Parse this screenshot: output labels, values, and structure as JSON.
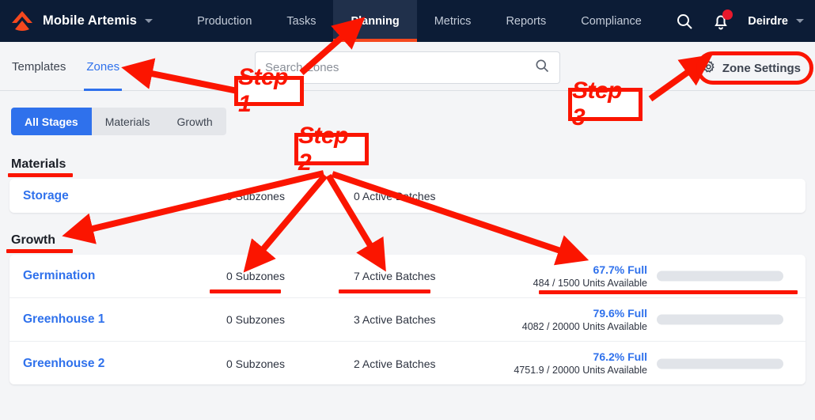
{
  "topnav": {
    "brand": "Mobile Artemis",
    "brand_caret_icon": "chevron-down-icon",
    "logo_icon": "artemis-chevron-logo",
    "links": [
      {
        "label": "Production",
        "active": false
      },
      {
        "label": "Tasks",
        "active": false
      },
      {
        "label": "Planning",
        "active": true
      },
      {
        "label": "Metrics",
        "active": false
      },
      {
        "label": "Reports",
        "active": false
      },
      {
        "label": "Compliance",
        "active": false
      }
    ],
    "search_icon": "search-icon",
    "notifications_icon": "bell-icon",
    "notification_badge": true,
    "user": "Deirdre",
    "user_caret_icon": "chevron-down-icon",
    "active_tab_underline_color": "#f4481e",
    "background_color": "#0c1c36"
  },
  "subnav": {
    "tabs": [
      {
        "label": "Templates",
        "active": false
      },
      {
        "label": "Zones",
        "active": true
      }
    ],
    "search": {
      "value": "",
      "placeholder": "Search Zones",
      "icon": "search-icon"
    },
    "zone_settings": {
      "label": "Zone Settings",
      "icon": "gear-icon"
    },
    "active_color": "#2f71ec"
  },
  "filters": {
    "options": [
      {
        "label": "All Stages",
        "active": true
      },
      {
        "label": "Materials",
        "active": false
      },
      {
        "label": "Growth",
        "active": false
      }
    ],
    "active_color": "#2f71ec"
  },
  "sections": [
    {
      "title": "Materials",
      "rows": [
        {
          "name": "Storage",
          "subzones": "0 Subzones",
          "batches": "0 Active Batches",
          "capacity_pct_label": "",
          "capacity_units_label": "",
          "capacity_pct": 0,
          "has_capacity": false
        }
      ]
    },
    {
      "title": "Growth",
      "rows": [
        {
          "name": "Germination",
          "subzones": "0 Subzones",
          "batches": "7 Active Batches",
          "capacity_pct_label": "67.7% Full",
          "capacity_units_label": "484 / 1500 Units Available",
          "capacity_pct": 67.7,
          "has_capacity": true
        },
        {
          "name": "Greenhouse 1",
          "subzones": "0 Subzones",
          "batches": "3 Active Batches",
          "capacity_pct_label": "79.6% Full",
          "capacity_units_label": "4082 / 20000 Units Available",
          "capacity_pct": 79.6,
          "has_capacity": true
        },
        {
          "name": "Greenhouse 2",
          "subzones": "0 Subzones",
          "batches": "2 Active Batches",
          "capacity_pct_label": "76.2% Full",
          "capacity_units_label": "4751.9 / 20000 Units Available",
          "capacity_pct": 76.2,
          "has_capacity": true
        }
      ]
    }
  ],
  "annotations": {
    "color": "#fb1500",
    "steps": [
      {
        "label": "Step 1"
      },
      {
        "label": "Step 2"
      },
      {
        "label": "Step 3"
      }
    ]
  }
}
